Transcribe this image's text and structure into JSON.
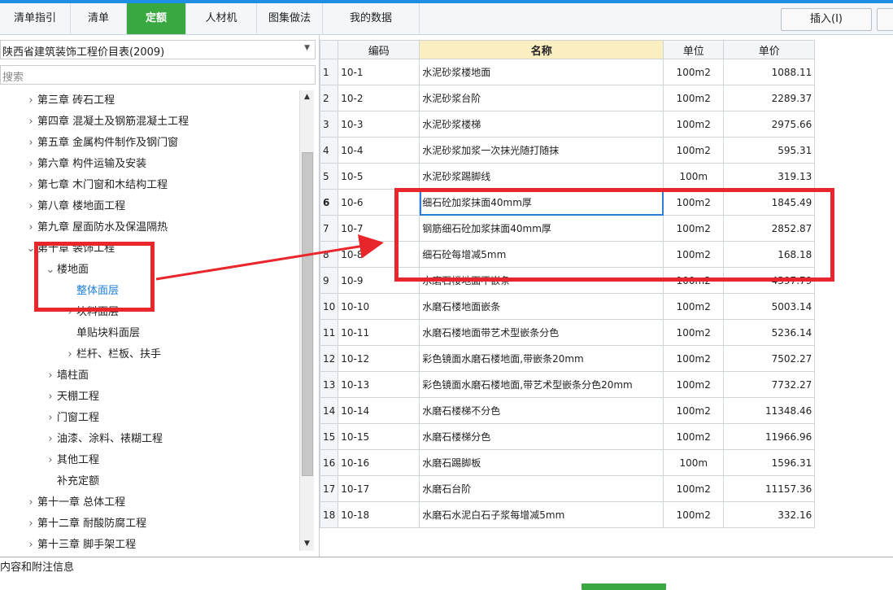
{
  "tabs": [
    {
      "label": "清单指引",
      "active": false
    },
    {
      "label": "清单",
      "active": false
    },
    {
      "label": "定额",
      "active": true
    },
    {
      "label": "人材机",
      "active": false
    },
    {
      "label": "图集做法",
      "active": false
    },
    {
      "label": "我的数据",
      "active": false
    }
  ],
  "toolbar": {
    "insert_label": "插入(I)"
  },
  "library": {
    "selected": "陕西省建筑装饰工程价目表(2009)"
  },
  "search": {
    "placeholder": "搜索"
  },
  "tree": [
    {
      "label": "第三章 砖石工程",
      "expand": ">",
      "level": 1
    },
    {
      "label": "第四章 混凝土及钢筋混凝土工程",
      "expand": ">",
      "level": 1
    },
    {
      "label": "第五章 金属构件制作及钢门窗",
      "expand": ">",
      "level": 1
    },
    {
      "label": "第六章 构件运输及安装",
      "expand": ">",
      "level": 1
    },
    {
      "label": "第七章 木门窗和木结构工程",
      "expand": ">",
      "level": 1
    },
    {
      "label": "第八章 楼地面工程",
      "expand": ">",
      "level": 1
    },
    {
      "label": "第九章 屋面防水及保温隔热",
      "expand": ">",
      "level": 1
    },
    {
      "label": "第十章 装饰工程",
      "expand": "v",
      "level": 1
    },
    {
      "label": "楼地面",
      "expand": "v",
      "level": 2
    },
    {
      "label": "整体面层",
      "expand": "",
      "level": 3,
      "selected": true
    },
    {
      "label": "块料面层",
      "expand": ">",
      "level": 3
    },
    {
      "label": "单贴块料面层",
      "expand": "",
      "level": 3
    },
    {
      "label": "栏杆、栏板、扶手",
      "expand": ">",
      "level": 3
    },
    {
      "label": "墙柱面",
      "expand": ">",
      "level": 2
    },
    {
      "label": "天棚工程",
      "expand": ">",
      "level": 2
    },
    {
      "label": "门窗工程",
      "expand": ">",
      "level": 2
    },
    {
      "label": "油漆、涂料、裱糊工程",
      "expand": ">",
      "level": 2
    },
    {
      "label": "其他工程",
      "expand": ">",
      "level": 2
    },
    {
      "label": "补充定额",
      "expand": "",
      "level": 2
    },
    {
      "label": "第十一章 总体工程",
      "expand": ">",
      "level": 1
    },
    {
      "label": "第十二章 耐酸防腐工程",
      "expand": ">",
      "level": 1
    },
    {
      "label": "第十三章 脚手架工程",
      "expand": ">",
      "level": 1
    }
  ],
  "table": {
    "headers": [
      "",
      "编码",
      "名称",
      "单位",
      "单价"
    ],
    "rows": [
      {
        "no": "1",
        "code": "10-1",
        "name": "水泥砂浆楼地面",
        "unit": "100m2",
        "price": "1088.11"
      },
      {
        "no": "2",
        "code": "10-2",
        "name": "水泥砂浆台阶",
        "unit": "100m2",
        "price": "2289.37"
      },
      {
        "no": "3",
        "code": "10-3",
        "name": "水泥砂浆楼梯",
        "unit": "100m2",
        "price": "2975.66"
      },
      {
        "no": "4",
        "code": "10-4",
        "name": "水泥砂浆加浆一次抹光随打随抹",
        "unit": "100m2",
        "price": "595.31"
      },
      {
        "no": "5",
        "code": "10-5",
        "name": "水泥砂浆踢脚线",
        "unit": "100m",
        "price": "319.13"
      },
      {
        "no": "6",
        "code": "10-6",
        "name": "细石砼加浆抹面40mm厚",
        "unit": "100m2",
        "price": "1845.49",
        "current": true
      },
      {
        "no": "7",
        "code": "10-7",
        "name": "钢筋细石砼加浆抹面40mm厚",
        "unit": "100m2",
        "price": "2852.87"
      },
      {
        "no": "8",
        "code": "10-8",
        "name": "细石砼每增减5mm",
        "unit": "100m2",
        "price": "168.18"
      },
      {
        "no": "9",
        "code": "10-9",
        "name": "水磨石楼地面不嵌条",
        "unit": "100m2",
        "price": "4397.79"
      },
      {
        "no": "10",
        "code": "10-10",
        "name": "水磨石楼地面嵌条",
        "unit": "100m2",
        "price": "5003.14"
      },
      {
        "no": "11",
        "code": "10-11",
        "name": "水磨石楼地面带艺术型嵌条分色",
        "unit": "100m2",
        "price": "5236.14"
      },
      {
        "no": "12",
        "code": "10-12",
        "name": "彩色镜面水磨石楼地面,带嵌条20mm",
        "unit": "100m2",
        "price": "7502.27"
      },
      {
        "no": "13",
        "code": "10-13",
        "name": "彩色镜面水磨石楼地面,带艺术型嵌条分色20mm",
        "unit": "100m2",
        "price": "7732.27"
      },
      {
        "no": "14",
        "code": "10-14",
        "name": "水磨石楼梯不分色",
        "unit": "100m2",
        "price": "11348.46"
      },
      {
        "no": "15",
        "code": "10-15",
        "name": "水磨石楼梯分色",
        "unit": "100m2",
        "price": "11966.96"
      },
      {
        "no": "16",
        "code": "10-16",
        "name": "水磨石踢脚板",
        "unit": "100m",
        "price": "1596.31"
      },
      {
        "no": "17",
        "code": "10-17",
        "name": "水磨石台阶",
        "unit": "100m2",
        "price": "11157.36"
      },
      {
        "no": "18",
        "code": "10-18",
        "name": "水磨石水泥白石子浆每增减5mm",
        "unit": "100m2",
        "price": "332.16"
      }
    ]
  },
  "status": {
    "text": "内容和附注信息"
  },
  "colors": {
    "accent": "#3aa840",
    "highlight": "#e8262b",
    "selection": "#1c7fd9"
  }
}
